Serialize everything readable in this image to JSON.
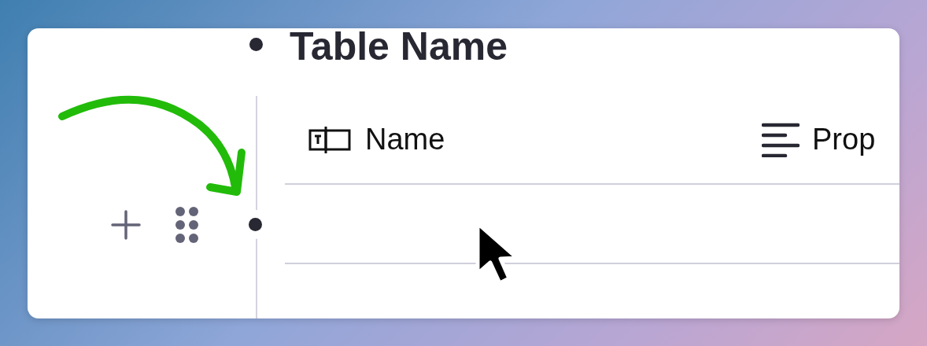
{
  "title": {
    "text": "Table Name"
  },
  "columns": [
    {
      "label": "Name",
      "kind": "text"
    },
    {
      "label": "Prop",
      "kind": "long-text"
    }
  ],
  "rows": [
    {
      "hovered": true
    }
  ]
}
